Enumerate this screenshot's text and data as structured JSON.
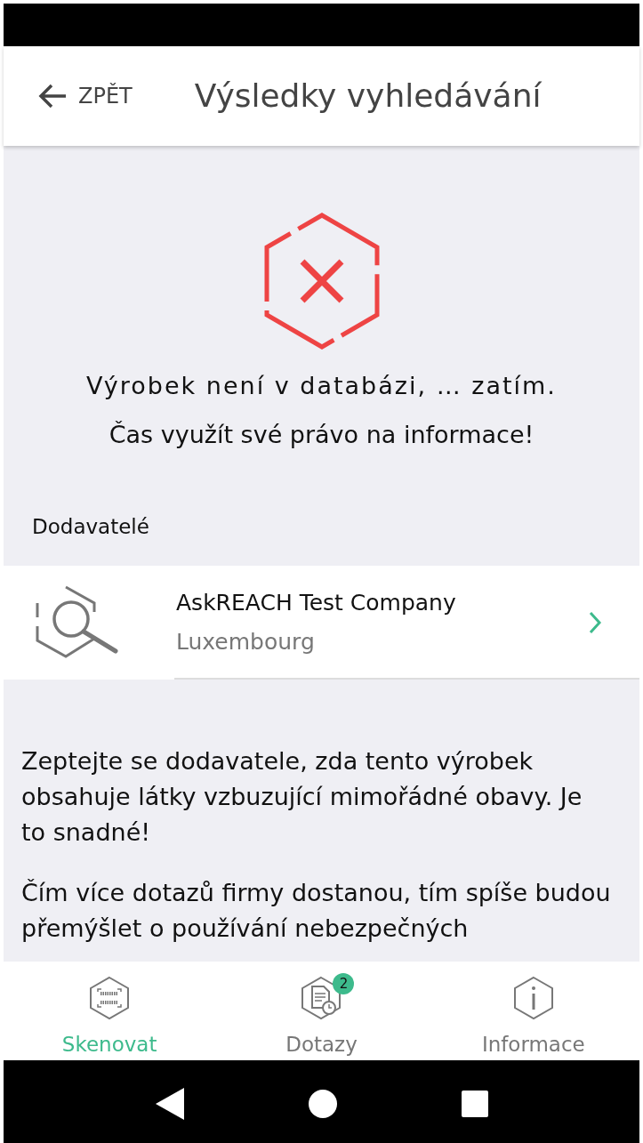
{
  "header": {
    "back_label": "ZPĚT",
    "title": "Výsledky vyhledávání"
  },
  "result": {
    "message": "Výrobek není v databázi, … zatím.",
    "call_to_action": "Čas využít své právo na informace!"
  },
  "suppliers": {
    "heading": "Dodavatelé",
    "items": [
      {
        "name": "AskREACH Test Company",
        "country": "Luxembourg"
      }
    ]
  },
  "paragraphs": [
    "Zeptejte se dodavatele, zda tento výrobek obsahuje látky vzbuzující mimořádné obavy. Je to snadné!",
    "Čím více dotazů firmy dostanou, tím spíše budou přemýšlet o používání nebezpečných"
  ],
  "bottom_nav": [
    {
      "kind": "scan",
      "label": "Skenovat",
      "selected": true
    },
    {
      "kind": "queries",
      "label": "Dotazy",
      "selected": false,
      "badge": "2"
    },
    {
      "kind": "info",
      "label": "Informace",
      "selected": false
    }
  ]
}
